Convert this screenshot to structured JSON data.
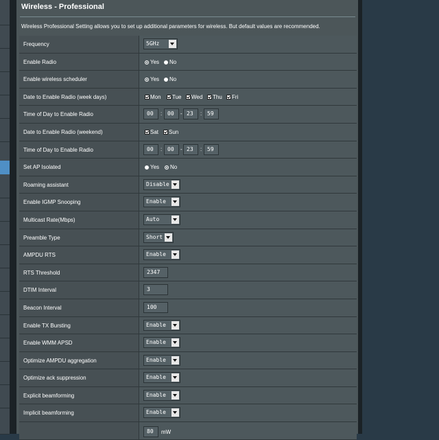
{
  "page": {
    "title": "Wireless - Professional",
    "description": "Wireless Professional Setting allows you to set up additional parameters for wireless. But default values are recommended."
  },
  "settings": {
    "frequency": {
      "label": "Frequency",
      "value": "5GHz"
    },
    "enable_radio": {
      "label": "Enable Radio",
      "yes": "Yes",
      "no": "No",
      "selected": "Yes"
    },
    "scheduler": {
      "label": "Enable wireless scheduler",
      "yes": "Yes",
      "no": "No",
      "selected": "Yes"
    },
    "weekdays": {
      "label": "Date to Enable Radio (week days)",
      "days": [
        "Mon",
        "Tue",
        "Wed",
        "Thu",
        "Fri"
      ]
    },
    "weekday_time": {
      "label": "Time of Day to Enable Radio",
      "start_h": "00",
      "start_m": "00",
      "end_h": "23",
      "end_m": "59",
      "colon": ":",
      "dash": "-"
    },
    "weekend": {
      "label": "Date to Enable Radio (weekend)",
      "days": [
        "Sat",
        "Sun"
      ]
    },
    "weekend_time": {
      "label": "Time of Day to Enable Radio",
      "start_h": "00",
      "start_m": "00",
      "end_h": "23",
      "end_m": "59",
      "colon": ":",
      "dash": "-"
    },
    "ap_isolated": {
      "label": "Set AP Isolated",
      "yes": "Yes",
      "no": "No",
      "selected": "No"
    },
    "roaming": {
      "label": "Roaming assistant",
      "value": "Disable"
    },
    "igmp": {
      "label": "Enable IGMP Snooping",
      "value": "Enable"
    },
    "multicast": {
      "label": "Multicast Rate(Mbps)",
      "value": "Auto"
    },
    "preamble": {
      "label": "Preamble Type",
      "value": "Short"
    },
    "ampdu_rts": {
      "label": "AMPDU RTS",
      "value": "Enable"
    },
    "rts_threshold": {
      "label": "RTS Threshold",
      "value": "2347"
    },
    "dtim": {
      "label": "DTIM Interval",
      "value": "3"
    },
    "beacon": {
      "label": "Beacon Interval",
      "value": "100"
    },
    "tx_bursting": {
      "label": "Enable TX Bursting",
      "value": "Enable"
    },
    "wmm_apsd": {
      "label": "Enable WMM APSD",
      "value": "Enable"
    },
    "ampdu_agg": {
      "label": "Optimize AMPDU aggregation",
      "value": "Enable"
    },
    "ack_supp": {
      "label": "Optimize ack suppression",
      "value": "Enable"
    },
    "explicit_bf": {
      "label": "Explicit beamforming",
      "value": "Enable"
    },
    "implicit_bf": {
      "label": "Implicit beamforming",
      "value": "Enable"
    },
    "tx_power": {
      "label": "",
      "value": "80",
      "unit": "mW"
    }
  }
}
